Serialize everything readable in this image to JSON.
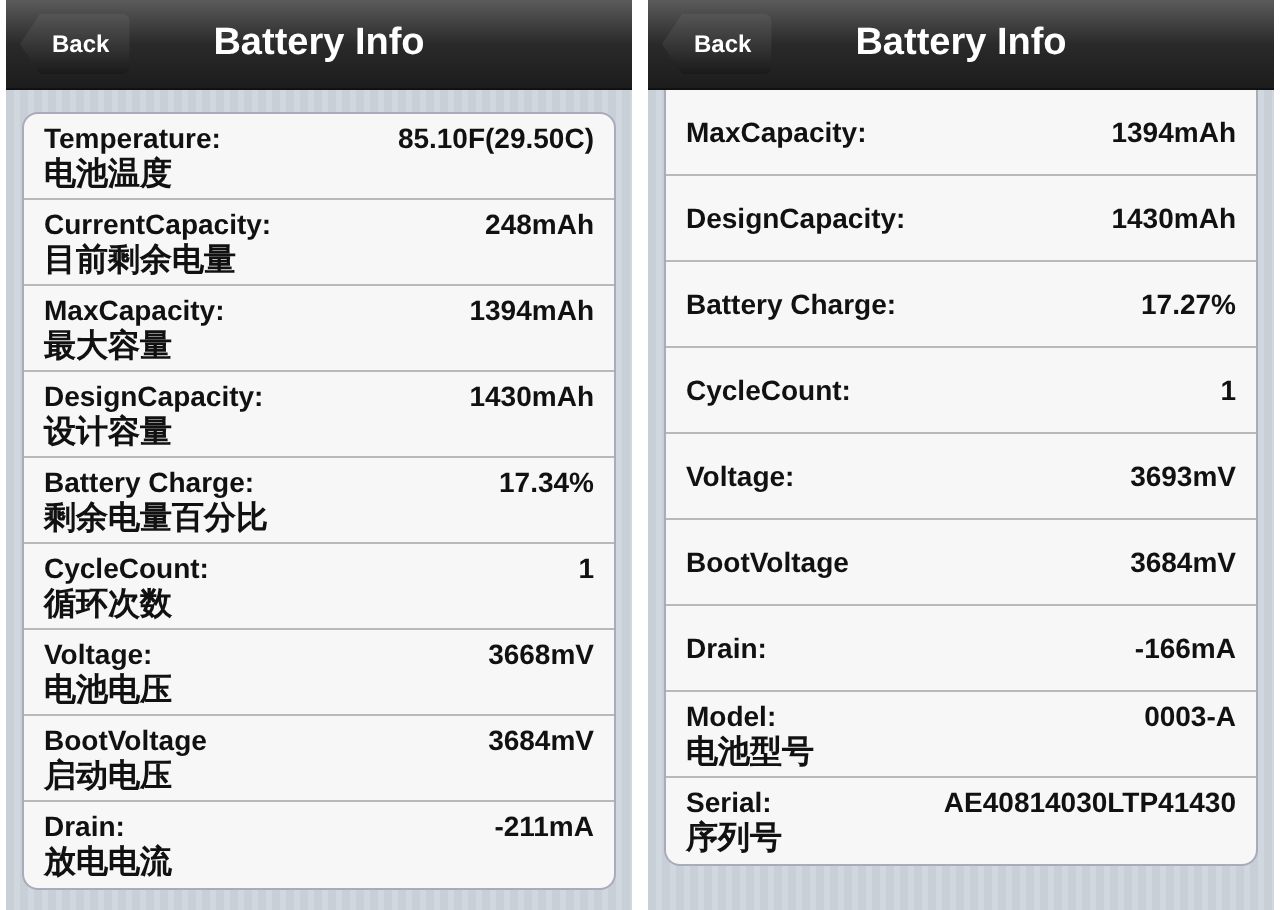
{
  "screens": [
    {
      "nav": {
        "back": "Back",
        "title": "Battery Info"
      },
      "scrolled": false,
      "rows": [
        {
          "label": "Temperature:",
          "value": "85.10F(29.50C)",
          "note": "电池温度"
        },
        {
          "label": "CurrentCapacity:",
          "value": "248mAh",
          "note": "目前剩余电量"
        },
        {
          "label": "MaxCapacity:",
          "value": "1394mAh",
          "note": "最大容量"
        },
        {
          "label": "DesignCapacity:",
          "value": "1430mAh",
          "note": "设计容量"
        },
        {
          "label": "Battery Charge:",
          "value": "17.34%",
          "note": "剩余电量百分比"
        },
        {
          "label": "CycleCount:",
          "value": "1",
          "note": "循环次数"
        },
        {
          "label": "Voltage:",
          "value": "3668mV",
          "note": "电池电压"
        },
        {
          "label": "BootVoltage",
          "value": "3684mV",
          "note": "启动电压"
        },
        {
          "label": "Drain:",
          "value": "-211mA",
          "note": "放电电流"
        }
      ]
    },
    {
      "nav": {
        "back": "Back",
        "title": "Battery Info"
      },
      "scrolled": true,
      "rows": [
        {
          "label": "MaxCapacity:",
          "value": "1394mAh"
        },
        {
          "label": "DesignCapacity:",
          "value": "1430mAh"
        },
        {
          "label": "Battery Charge:",
          "value": "17.27%"
        },
        {
          "label": "CycleCount:",
          "value": "1"
        },
        {
          "label": "Voltage:",
          "value": "3693mV"
        },
        {
          "label": "BootVoltage",
          "value": "3684mV"
        },
        {
          "label": "Drain:",
          "value": "-166mA"
        },
        {
          "label": "Model:",
          "value": "0003-A",
          "note": "电池型号"
        },
        {
          "label": "Serial:",
          "value": "AE40814030LTP41430",
          "note": "序列号"
        }
      ]
    }
  ]
}
